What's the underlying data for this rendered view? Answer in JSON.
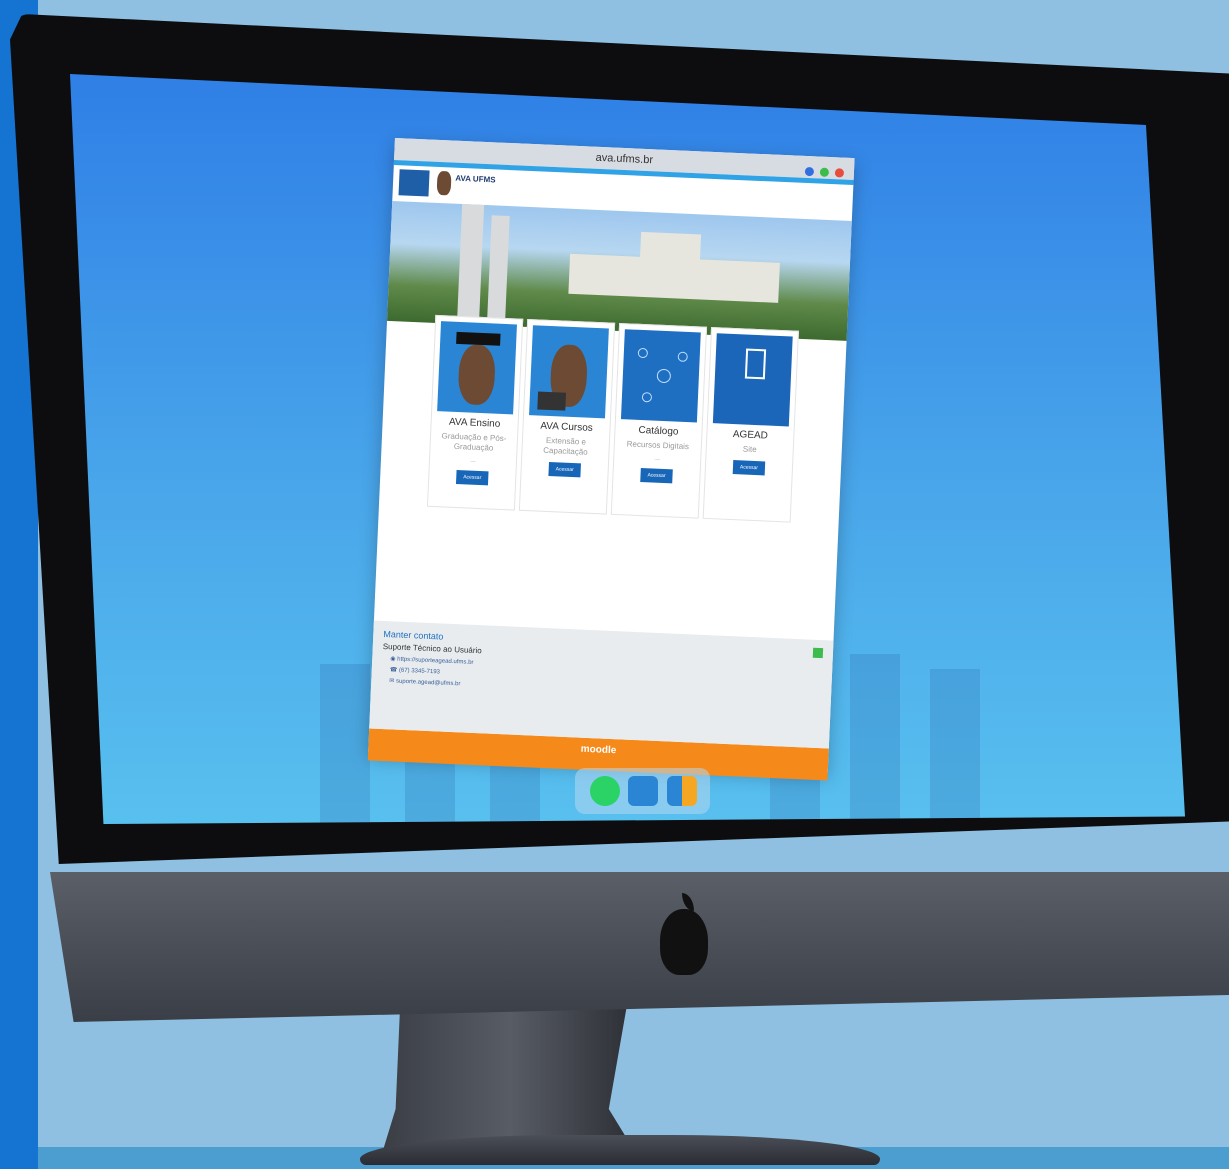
{
  "browser": {
    "address": "ava.ufms.br",
    "window_dots": [
      "#2f6fe0",
      "#3cbc4b",
      "#e74c3c"
    ]
  },
  "header": {
    "brand": "AVA UFMS"
  },
  "cards": [
    {
      "title": "AVA Ensino",
      "subtitle": "Graduação e Pós-Graduação",
      "button": "Acessar"
    },
    {
      "title": "AVA Cursos",
      "subtitle": "Extensão e Capacitação",
      "button": "Acessar"
    },
    {
      "title": "Catálogo",
      "subtitle": "Recursos Digitais",
      "button": "Acessar"
    },
    {
      "title": "AGEAD",
      "subtitle": "Site",
      "button": "Acessar"
    }
  ],
  "contact": {
    "title": "Manter contato",
    "subtitle": "Suporte Técnico ao Usuário",
    "url": "https://suporteagead.ufms.br",
    "phone": "(67) 3345-7193",
    "email": "suporte.agead@ufms.br"
  },
  "footer": {
    "moodle": "moodle"
  },
  "dock": {
    "items": [
      "whatsapp-icon",
      "ava-app-icon",
      "learning-app-icon"
    ]
  },
  "colors": {
    "accent": "#1866b8",
    "footer": "#f58a1a",
    "screen_top": "#2f7fe6",
    "screen_bottom": "#58c0ef"
  }
}
